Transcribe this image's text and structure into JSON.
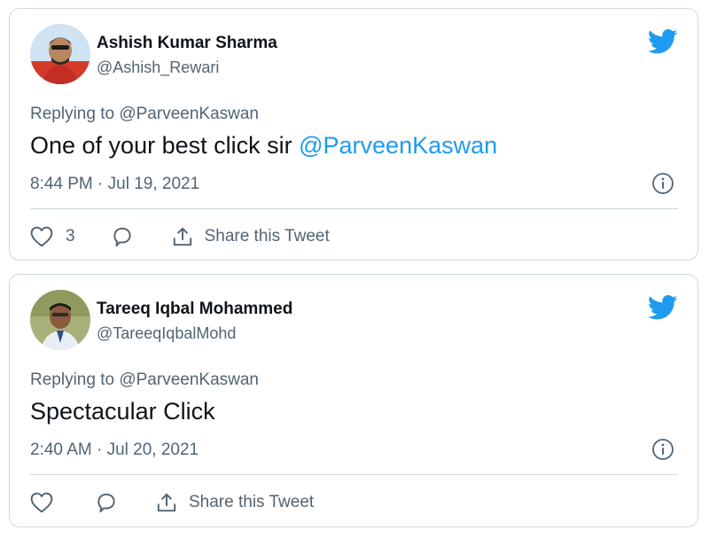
{
  "tweets": [
    {
      "author_name": "Ashish Kumar Sharma",
      "handle": "@Ashish_Rewari",
      "replying_prefix": "Replying to ",
      "replying_to": "@ParveenKaswan",
      "text": "One of your best click sir ",
      "mention": "@ParveenKaswan",
      "timestamp": "8:44 PM · Jul 19, 2021",
      "like_count": "3",
      "share_label": "Share this Tweet"
    },
    {
      "author_name": "Tareeq Iqbal Mohammed",
      "handle": "@TareeqIqbalMohd",
      "replying_prefix": "Replying to ",
      "replying_to": "@ParveenKaswan",
      "text": "Spectacular Click",
      "timestamp": "2:40 AM · Jul 20, 2021",
      "share_label": "Share this Tweet"
    }
  ],
  "icons": {
    "brand": "twitter-bird-icon",
    "info": "info-icon",
    "like": "heart-icon",
    "reply": "reply-bubble-icon",
    "share": "share-upload-icon"
  },
  "colors": {
    "accent": "#1d9bf0",
    "text": "#0f1419",
    "secondary": "#536471",
    "border": "#cfd9de"
  }
}
